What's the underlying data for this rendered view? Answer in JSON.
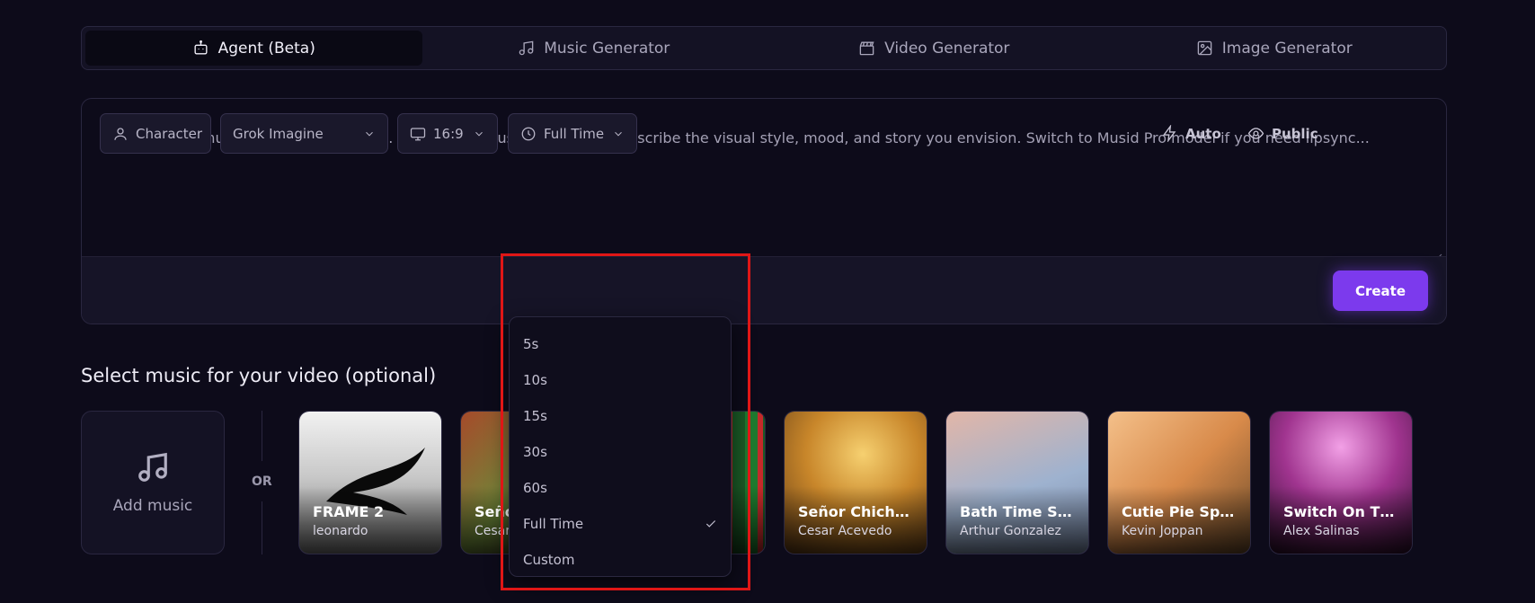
{
  "tabs": [
    {
      "label": "Agent (Beta)",
      "icon": "robot-icon",
      "active": true
    },
    {
      "label": "Music Generator",
      "icon": "music-note-icon",
      "active": false
    },
    {
      "label": "Video Generator",
      "icon": "clapperboard-icon",
      "active": false
    },
    {
      "label": "Image Generator",
      "icon": "image-icon",
      "active": false
    }
  ],
  "prompt": {
    "placeholder": "Create a full music video with AI Agent. Select your music below, then describe the visual style, mood, and story you envision. Switch to Musid Pro model if you need lipsync..."
  },
  "toolbar": {
    "character_label": "Character",
    "model_label": "Grok Imagine",
    "aspect_label": "16:9",
    "duration_label": "Full Time",
    "auto_label": "Auto",
    "visibility_label": "Public",
    "create_label": "Create"
  },
  "duration_dropdown": {
    "options": [
      "5s",
      "10s",
      "15s",
      "30s",
      "60s",
      "Full Time",
      "Custom"
    ],
    "selected": "Full Time"
  },
  "music": {
    "section_title": "Select music for your video (optional)",
    "add_label": "Add music",
    "or_label": "OR",
    "cards": [
      {
        "title": "FRAME 2",
        "artist": "leonardo"
      },
      {
        "title": "Señor",
        "artist": "Cesar"
      },
      {
        "title": "...",
        "artist": ""
      },
      {
        "title": "Señor Chicha...",
        "artist": "Cesar Acevedo"
      },
      {
        "title": "Bath Time So...",
        "artist": "Arthur Gonzalez"
      },
      {
        "title": "Cutie Pie Spark",
        "artist": "Kevin Joppan"
      },
      {
        "title": "Switch On Th...",
        "artist": "Alex Salinas"
      }
    ]
  },
  "colors": {
    "background": "#0d0b1a",
    "accent": "#7c3aed",
    "highlight": "#e01616"
  }
}
